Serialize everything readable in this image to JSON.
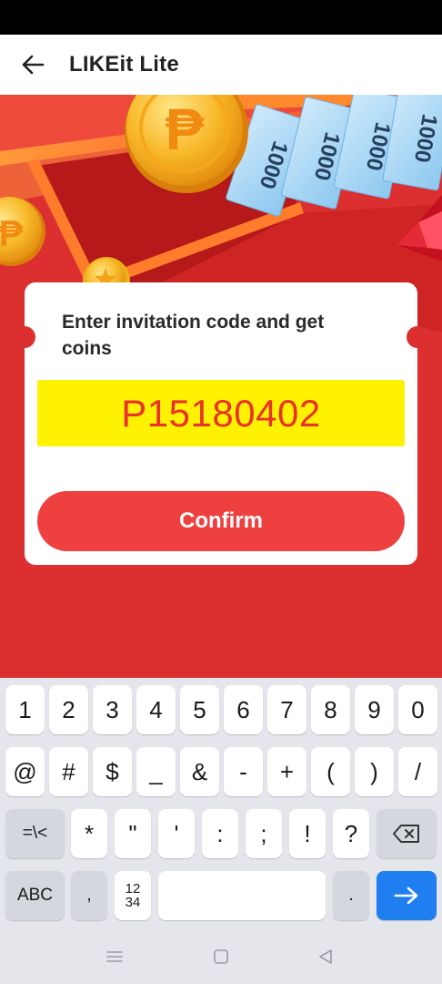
{
  "header": {
    "title": "LIKEit Lite"
  },
  "promo": {
    "banknote_label": "1000",
    "coin_symbol": "₱"
  },
  "invite_card": {
    "prompt": "Enter invitation code and get coins",
    "code": "P15180402",
    "confirm_label": "Confirm"
  },
  "keyboard": {
    "row1": [
      "1",
      "2",
      "3",
      "4",
      "5",
      "6",
      "7",
      "8",
      "9",
      "0"
    ],
    "row2": [
      "@",
      "#",
      "$",
      "_",
      "&",
      "-",
      "+",
      "(",
      ")",
      "/"
    ],
    "row3": {
      "shift_label": "=\\<",
      "keys": [
        "*",
        "\"",
        "'",
        ":",
        ";",
        "!",
        "?"
      ]
    },
    "row4": {
      "abc_label": "ABC",
      "comma": ",",
      "numpad_top": "12",
      "numpad_bottom": "34",
      "period": "."
    }
  },
  "colors": {
    "promo_background": "#dc2f2f",
    "code_highlight": "#fff200",
    "code_text": "#e9322d",
    "confirm_button": "#ef4040",
    "enter_key": "#1f7ff1",
    "keyboard_background": "#e4e6ec"
  },
  "icons": {
    "back": "arrow-left-icon",
    "backspace": "backspace-icon",
    "enter": "arrow-right-icon",
    "nav_menu": "menu-icon",
    "nav_home": "square-home-icon",
    "nav_back": "triangle-back-icon"
  }
}
